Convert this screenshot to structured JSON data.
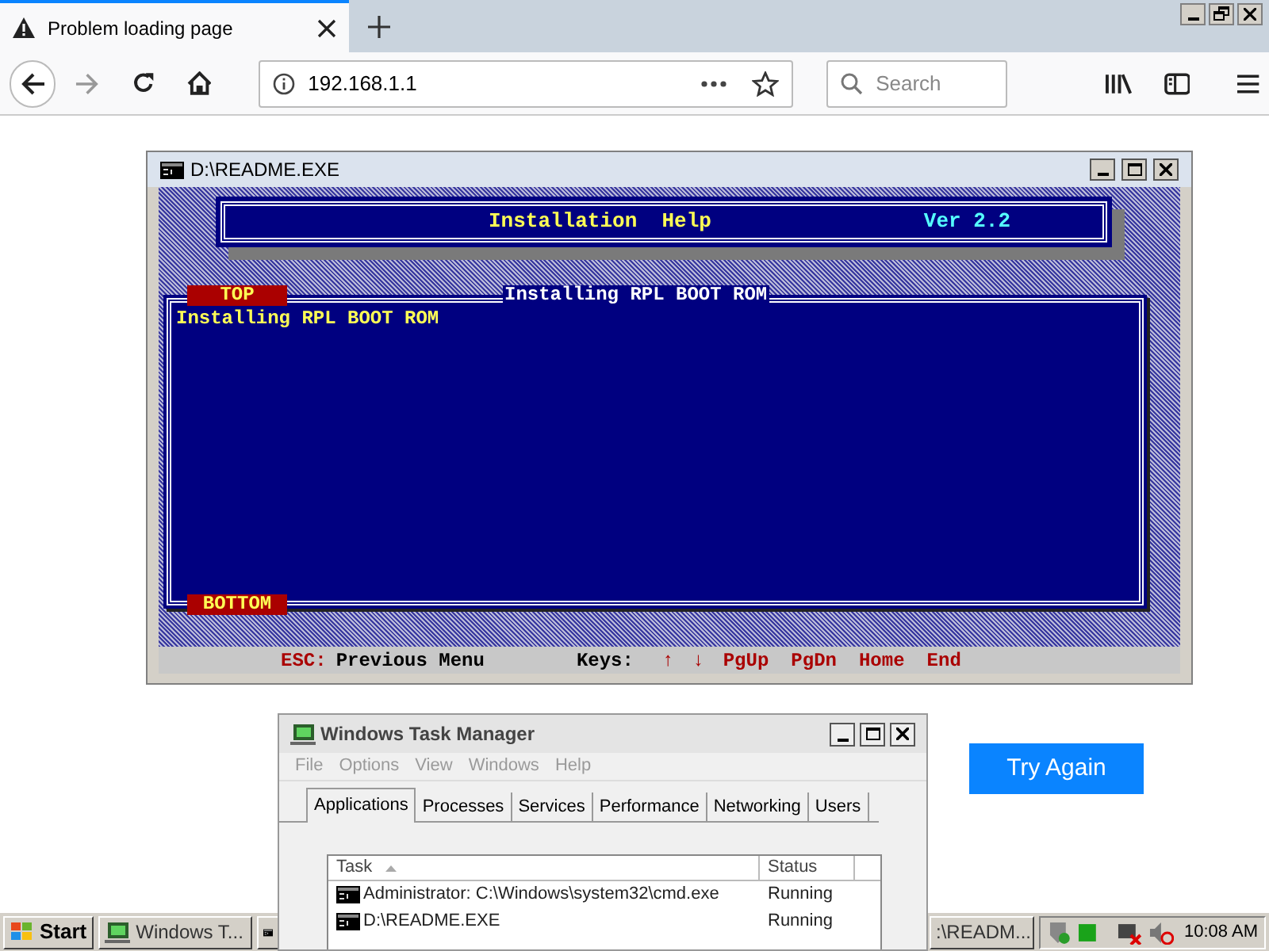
{
  "browser": {
    "tab_title": "Problem loading page",
    "url": "192.168.1.1",
    "search": {
      "placeholder": "Search"
    },
    "try_again": "Try Again"
  },
  "dos_window": {
    "title": "D:\\README.EXE",
    "header_title": "Installation  Help",
    "version": "Ver 2.2",
    "panel_title": "Installing RPL BOOT ROM",
    "top_label": "TOP",
    "bottom_label": "BOTTOM",
    "lines": [
      "Installing RPL BOOT ROM"
    ],
    "footer": [
      {
        "text": "ESC:",
        "kind": "key"
      },
      {
        "text": "Previous Menu",
        "kind": "label"
      },
      {
        "text": "Keys:",
        "kind": "label"
      },
      {
        "text": "↑",
        "kind": "key"
      },
      {
        "text": "↓",
        "kind": "key"
      },
      {
        "text": "PgUp",
        "kind": "key"
      },
      {
        "text": "PgDn",
        "kind": "key"
      },
      {
        "text": "Home",
        "kind": "key"
      },
      {
        "text": "End",
        "kind": "key"
      }
    ]
  },
  "task_manager": {
    "title": "Windows Task Manager",
    "menu": [
      "File",
      "Options",
      "View",
      "Windows",
      "Help"
    ],
    "tabs": [
      {
        "label": "Applications",
        "selected": true
      },
      {
        "label": "Processes",
        "selected": false
      },
      {
        "label": "Services",
        "selected": false
      },
      {
        "label": "Performance",
        "selected": false
      },
      {
        "label": "Networking",
        "selected": false
      },
      {
        "label": "Users",
        "selected": false
      }
    ],
    "columns": [
      "Task",
      "Status"
    ],
    "rows": [
      {
        "task": "Administrator: C:\\Windows\\system32\\cmd.exe",
        "status": "Running"
      },
      {
        "task": "D:\\README.EXE",
        "status": "Running"
      }
    ]
  },
  "taskbar": {
    "start": "Start",
    "buttons": [
      {
        "kind": "taskmgr",
        "label": "Windows T..."
      },
      {
        "kind": "console"
      },
      {
        "kind": "console",
        "label": ":\\READM..."
      }
    ],
    "clock": "10:08 AM"
  }
}
